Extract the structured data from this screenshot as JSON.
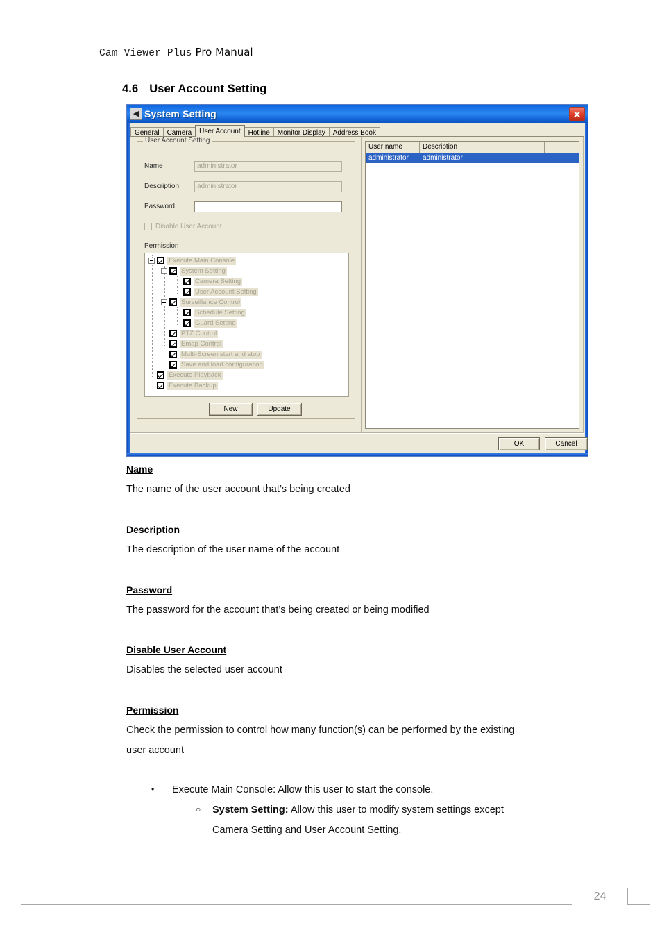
{
  "page_header": {
    "product": "Cam Viewer Plus",
    "suffix": "Pro Manual"
  },
  "section": {
    "number": "4.6",
    "title": "User Account Setting"
  },
  "dialog": {
    "title": "System Setting",
    "title_icon": "camera-icon",
    "close_label": "✕",
    "tabs": [
      {
        "label": "General",
        "active": false
      },
      {
        "label": "Camera",
        "active": false
      },
      {
        "label": "User Account",
        "active": true
      },
      {
        "label": "Hotline",
        "active": false
      },
      {
        "label": "Monitor Display",
        "active": false
      },
      {
        "label": "Address Book",
        "active": false
      }
    ],
    "group_title": "User Account Setting",
    "fields": [
      {
        "label": "Name",
        "value": "administrator",
        "placeholder": "",
        "disabled": true
      },
      {
        "label": "Description",
        "value": "administrator",
        "placeholder": "",
        "disabled": true
      },
      {
        "label": "Password",
        "value": "",
        "placeholder": "",
        "disabled": false
      }
    ],
    "disable_account": {
      "label": "Disable User Account",
      "checked": false
    },
    "permission_label": "Permission",
    "permission_tree": [
      {
        "label": "Execute Main Console",
        "level": 1,
        "expander": true,
        "checked": true
      },
      {
        "label": "System Setting",
        "level": 2,
        "expander": true,
        "checked": true
      },
      {
        "label": "Camera Setting",
        "level": 3,
        "expander": false,
        "checked": true
      },
      {
        "label": "User Account Setting",
        "level": 3,
        "expander": false,
        "checked": true
      },
      {
        "label": "Surveillance Control",
        "level": 2,
        "expander": true,
        "checked": true
      },
      {
        "label": "Schedule Setting",
        "level": 3,
        "expander": false,
        "checked": true
      },
      {
        "label": "Guard Setting",
        "level": 3,
        "expander": false,
        "checked": true
      },
      {
        "label": "PTZ Control",
        "level": 2,
        "expander": false,
        "checked": true
      },
      {
        "label": "Emap Control",
        "level": 2,
        "expander": false,
        "checked": true
      },
      {
        "label": "Multi-Screen start and stop",
        "level": 2,
        "expander": false,
        "checked": true
      },
      {
        "label": "Save and load configuration",
        "level": 2,
        "expander": false,
        "checked": true
      },
      {
        "label": "Execute Playback",
        "level": 1,
        "expander": false,
        "checked": true
      },
      {
        "label": "Execute Backup",
        "level": 1,
        "expander": false,
        "checked": true
      }
    ],
    "new_button": "New",
    "update_button": "Update",
    "list": {
      "columns": [
        "User name",
        "Description",
        ""
      ],
      "rows": [
        {
          "user_name": "administrator",
          "description": "administrator",
          "selected": true
        }
      ]
    },
    "ok_button": "OK",
    "cancel_button": "Cancel"
  },
  "body": {
    "sections": [
      {
        "title": "Name",
        "text": "The name of the user account that’s being created"
      },
      {
        "title": "Description",
        "text": "The description of the user name of the account"
      },
      {
        "title": "Password",
        "text": "The password for the account that’s being created or being modified"
      },
      {
        "title": "Disable User Account",
        "text": "Disables the selected user account"
      },
      {
        "title": "Permission",
        "text": "Check the permission to control how many function(s) can be performed by the existing"
      }
    ],
    "permission_text_line2": "user account",
    "bullets": {
      "level1_marker": "•",
      "level1_text": "Execute Main Console: Allow this user to start the console.",
      "level2_marker": "○",
      "level2_bold": "System Setting:",
      "level2_text": " Allow this user to modify system settings except",
      "level2_cont": "Camera Setting and User Account Setting."
    }
  },
  "footer": {
    "page_number": "24"
  }
}
